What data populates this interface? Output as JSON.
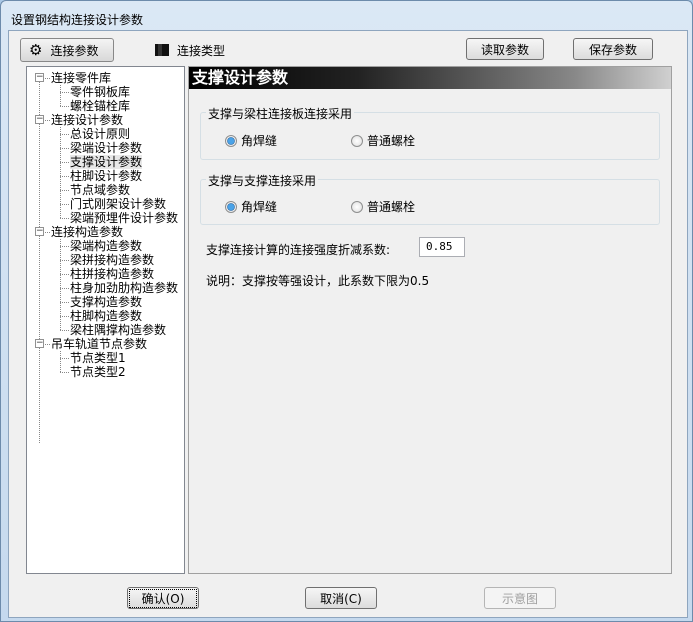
{
  "window": {
    "title": "设置钢结构连接设计参数"
  },
  "toolbar": {
    "tab_params": "连接参数",
    "tab_types": "连接类型",
    "read_button": "读取参数",
    "save_button": "保存参数"
  },
  "tree": [
    {
      "label": "连接零件库",
      "children": [
        "零件钢板库",
        "螺栓锚栓库"
      ]
    },
    {
      "label": "连接设计参数",
      "children": [
        "总设计原则",
        "梁端设计参数",
        "支撑设计参数",
        "柱脚设计参数",
        "节点域参数",
        "门式刚架设计参数",
        "梁端预埋件设计参数"
      ]
    },
    {
      "label": "连接构造参数",
      "children": [
        "梁端构造参数",
        "梁拼接构造参数",
        "柱拼接构造参数",
        "柱身加劲肋构造参数",
        "支撑构造参数",
        "柱脚构造参数",
        "梁柱隅撑构造参数"
      ]
    },
    {
      "label": "吊车轨道节点参数",
      "children": [
        "节点类型1",
        "节点类型2"
      ]
    }
  ],
  "selected_node": "支撑设计参数",
  "panel": {
    "title": "支撑设计参数",
    "group1": {
      "label": "支撑与梁柱连接板连接采用",
      "options": [
        "角焊缝",
        "普通螺栓"
      ],
      "selected": "角焊缝"
    },
    "group2": {
      "label": "支撑与支撑连接采用",
      "options": [
        "角焊缝",
        "普通螺栓"
      ],
      "selected": "角焊缝"
    },
    "coef_label": "支撑连接计算的连接强度折减系数:",
    "coef_value": "0.85",
    "note": "说明：支撑按等强设计，此系数下限为0.5"
  },
  "footer": {
    "ok": "确认(O)",
    "cancel": "取消(C)",
    "diagram": "示意图"
  }
}
